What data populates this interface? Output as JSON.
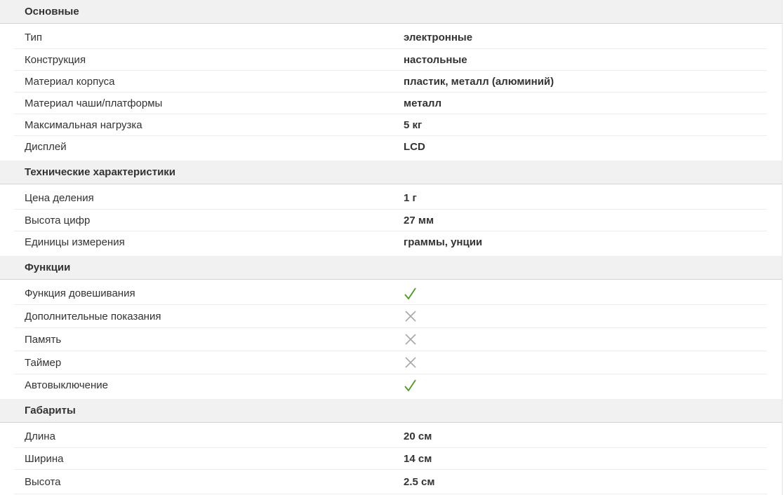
{
  "sections": [
    {
      "title": "Основные",
      "rows": [
        {
          "label": "Тип",
          "value": "электронные"
        },
        {
          "label": "Конструкция",
          "value": "настольные"
        },
        {
          "label": "Материал корпуса",
          "value": "пластик, металл  (алюминий)"
        },
        {
          "label": "Материал чаши/платформы",
          "value": "металл"
        },
        {
          "label": "Максимальная нагрузка",
          "value": "5 кг"
        },
        {
          "label": "Дисплей",
          "value": "LCD"
        }
      ]
    },
    {
      "title": "Технические характеристики",
      "rows": [
        {
          "label": "Цена деления",
          "value": "1 г"
        },
        {
          "label": "Высота цифр",
          "value": "27 мм"
        },
        {
          "label": "Единицы измерения",
          "value": "граммы, унции"
        }
      ]
    },
    {
      "title": "Функции",
      "rows": [
        {
          "label": "Функция довешивания",
          "icon": "check-icon"
        },
        {
          "label": "Дополнительные показания",
          "icon": "cross-icon"
        },
        {
          "label": "Память",
          "icon": "cross-icon"
        },
        {
          "label": "Таймер",
          "icon": "cross-icon"
        },
        {
          "label": "Автовыключение",
          "icon": "check-icon"
        }
      ]
    },
    {
      "title": "Габариты",
      "rows": [
        {
          "label": "Длина",
          "value": "20 см"
        },
        {
          "label": "Ширина",
          "value": "14 см"
        },
        {
          "label": "Высота",
          "value": "2.5 см"
        }
      ]
    }
  ],
  "colors": {
    "header_bg": "#f1f1f1",
    "check": "#4a9a1a",
    "cross": "#a8a8a8",
    "text": "#333333"
  }
}
